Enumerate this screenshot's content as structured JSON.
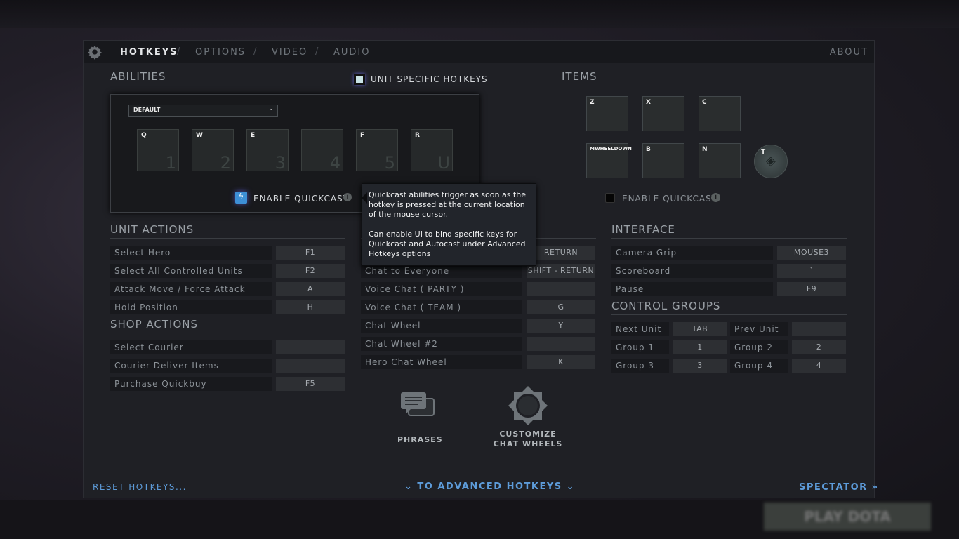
{
  "tabs": [
    {
      "label": "HOTKEYS",
      "active": true
    },
    {
      "label": "OPTIONS"
    },
    {
      "label": "VIDEO"
    },
    {
      "label": "AUDIO"
    }
  ],
  "tab_separator": "/",
  "about": "ABOUT",
  "abilities": {
    "title": "ABILITIES",
    "dropdown": "DEFAULT",
    "slots": [
      {
        "key": "Q",
        "num": "1"
      },
      {
        "key": "W",
        "num": "2"
      },
      {
        "key": "E",
        "num": "3"
      },
      {
        "key": "",
        "num": "4"
      },
      {
        "key": "F",
        "num": "5"
      },
      {
        "key": "R",
        "num": "U"
      }
    ],
    "quickcast": "ENABLE QUICKCAST",
    "quickcast_checked": true
  },
  "unit_specific": {
    "label": "UNIT SPECIFIC HOTKEYS",
    "checked": true
  },
  "items": {
    "title": "ITEMS",
    "slots": [
      "Z",
      "X",
      "C",
      "MWHEELDOWN",
      "B",
      "N"
    ],
    "tp_key": "T",
    "quickcast": "ENABLE QUICKCAST",
    "quickcast_checked": false
  },
  "tooltip": {
    "p1": "Quickcast abilities trigger as soon as the hotkey is pressed at the current location of the mouse cursor.",
    "p2": "Can enable UI to bind specific keys for Quickcast and Autocast under Advanced Hotkeys options"
  },
  "unit_actions": {
    "title": "UNIT ACTIONS",
    "rows": [
      {
        "label": "Select Hero",
        "key": "F1"
      },
      {
        "label": "Select All Controlled Units",
        "key": "F2"
      },
      {
        "label": "Attack Move / Force Attack",
        "key": "A"
      },
      {
        "label": "Hold Position",
        "key": "H"
      }
    ]
  },
  "shop_actions": {
    "title": "SHOP ACTIONS",
    "rows": [
      {
        "label": "Select Courier",
        "key": ""
      },
      {
        "label": "Courier Deliver Items",
        "key": ""
      },
      {
        "label": "Purchase Quickbuy",
        "key": "F5"
      }
    ]
  },
  "chat": {
    "rows": [
      {
        "label": "",
        "key": "RETURN"
      },
      {
        "label": "Chat to Everyone",
        "key": "SHIFT - RETURN"
      },
      {
        "label": "Voice Chat ( PARTY )",
        "key": ""
      },
      {
        "label": "Voice Chat ( TEAM )",
        "key": "G"
      },
      {
        "label": "Chat Wheel",
        "key": "Y"
      },
      {
        "label": "Chat Wheel #2",
        "key": ""
      },
      {
        "label": "Hero Chat Wheel",
        "key": "K"
      }
    ]
  },
  "interface": {
    "title": "INTERFACE",
    "rows": [
      {
        "label": "Camera Grip",
        "key": "MOUSE3"
      },
      {
        "label": "Scoreboard",
        "key": "`"
      },
      {
        "label": "Pause",
        "key": "F9"
      }
    ]
  },
  "control_groups": {
    "title": "CONTROL GROUPS",
    "rows": [
      [
        {
          "label": "Next Unit",
          "key": "TAB"
        },
        {
          "label": "Prev Unit",
          "key": ""
        }
      ],
      [
        {
          "label": "Group 1",
          "key": "1"
        },
        {
          "label": "Group 2",
          "key": "2"
        }
      ],
      [
        {
          "label": "Group 3",
          "key": "3"
        },
        {
          "label": "Group 4",
          "key": "4"
        }
      ]
    ]
  },
  "phrases": "PHRASES",
  "customize": [
    "CUSTOMIZE",
    "CHAT WHEELS"
  ],
  "reset": "RESET HOTKEYS...",
  "advanced": "TO ADVANCED HOTKEYS",
  "spectator": "SPECTATOR »",
  "play": "PLAY DOTA",
  "colors": {
    "accent": "#5d9bd9",
    "panel": "#1f2025"
  }
}
